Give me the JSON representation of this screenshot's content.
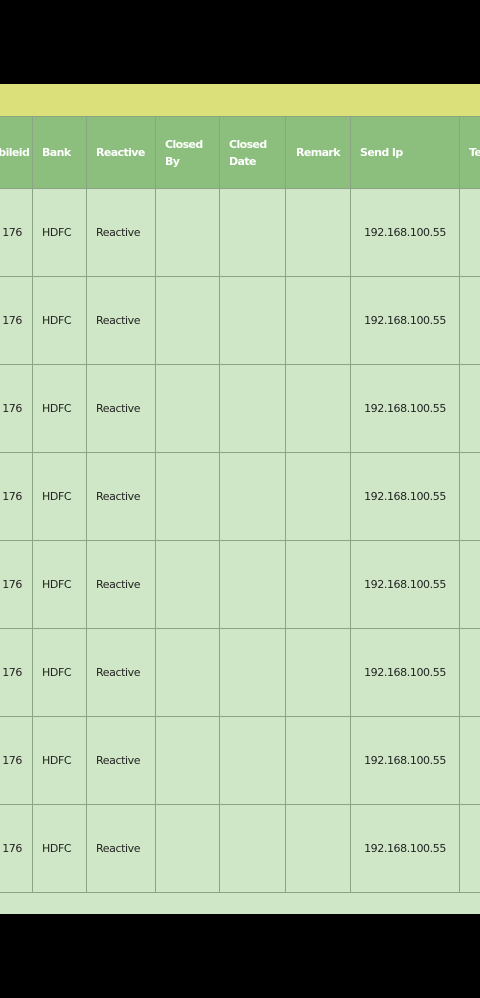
{
  "table": {
    "headers": [
      "Mobileid",
      "Bank",
      "Reactive",
      "Closed By",
      "Closed Date",
      "Remark",
      "Send Ip",
      "Te"
    ],
    "rows": [
      {
        "id": "176",
        "bank": "HDFC",
        "status": "Reactive",
        "closed_by": "",
        "closed_date": "",
        "remark": "",
        "send_ip": "192.168.100.55",
        "extra": ""
      },
      {
        "id": "176",
        "bank": "HDFC",
        "status": "Reactive",
        "closed_by": "",
        "closed_date": "",
        "remark": "",
        "send_ip": "192.168.100.55",
        "extra": ""
      },
      {
        "id": "176",
        "bank": "HDFC",
        "status": "Reactive",
        "closed_by": "",
        "closed_date": "",
        "remark": "",
        "send_ip": "192.168.100.55",
        "extra": ""
      },
      {
        "id": "176",
        "bank": "HDFC",
        "status": "Reactive",
        "closed_by": "",
        "closed_date": "",
        "remark": "",
        "send_ip": "192.168.100.55",
        "extra": ""
      },
      {
        "id": "176",
        "bank": "HDFC",
        "status": "Reactive",
        "closed_by": "",
        "closed_date": "",
        "remark": "",
        "send_ip": "192.168.100.55",
        "extra": ""
      },
      {
        "id": "176",
        "bank": "HDFC",
        "status": "Reactive",
        "closed_by": "",
        "closed_date": "",
        "remark": "",
        "send_ip": "192.168.100.55",
        "extra": ""
      },
      {
        "id": "176",
        "bank": "HDFC",
        "status": "Reactive",
        "closed_by": "",
        "closed_date": "",
        "remark": "",
        "send_ip": "192.168.100.55",
        "extra": ""
      },
      {
        "id": "176",
        "bank": "HDFC",
        "status": "Reactive",
        "closed_by": "",
        "closed_date": "",
        "remark": "",
        "send_ip": "192.168.100.55",
        "extra": ""
      }
    ]
  },
  "colors": {
    "frame": "#dbe07a",
    "header_bg": "#8cbf7d",
    "cell_bg": "#cfe7c6",
    "border": "#8aa583"
  }
}
